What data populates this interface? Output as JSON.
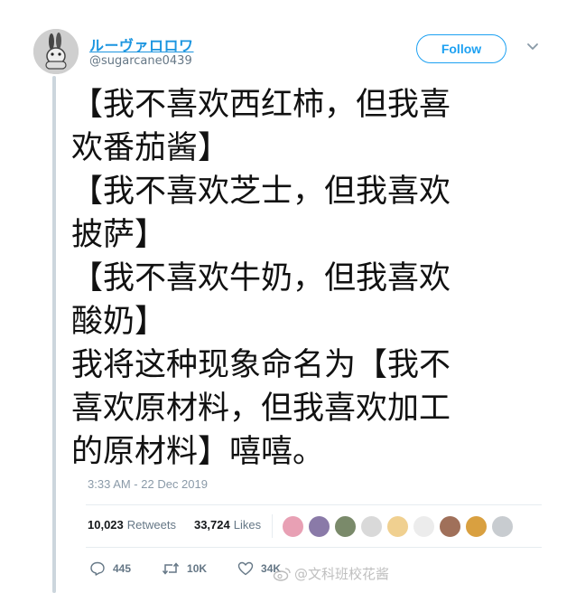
{
  "profile": {
    "display_name": "ルーヴァロロワ",
    "handle": "@sugarcane0439"
  },
  "header": {
    "follow_label": "Follow"
  },
  "tweet": {
    "lines": [
      "【我不喜欢西红柿，但我喜",
      "欢番茄酱】",
      " 【我不喜欢芝士，但我喜欢",
      "披萨】",
      " 【我不喜欢牛奶，但我喜欢",
      "酸奶】",
      " 我将这种现象命名为【我不",
      "喜欢原材料，但我喜欢加工",
      "的原材料】嘻嘻。"
    ],
    "timestamp": "3:33 AM - 22 Dec 2019"
  },
  "stats": {
    "retweets_count": "10,023",
    "retweets_label": "Retweets",
    "likes_count": "33,724",
    "likes_label": "Likes"
  },
  "liker_avatar_colors": [
    "#e8a0b4",
    "#8a7aa8",
    "#7a8a6a",
    "#d9d9d9",
    "#f0d090",
    "#ececec",
    "#a0705a",
    "#d9a040",
    "#c8ccd0"
  ],
  "actions": {
    "reply_count": "445",
    "retweet_count": "10K",
    "like_count": "34K"
  },
  "watermark": {
    "text": "@文科班校花酱"
  },
  "colors": {
    "accent": "#1da1f2",
    "link": "#1b95e0",
    "muted": "#657786"
  }
}
